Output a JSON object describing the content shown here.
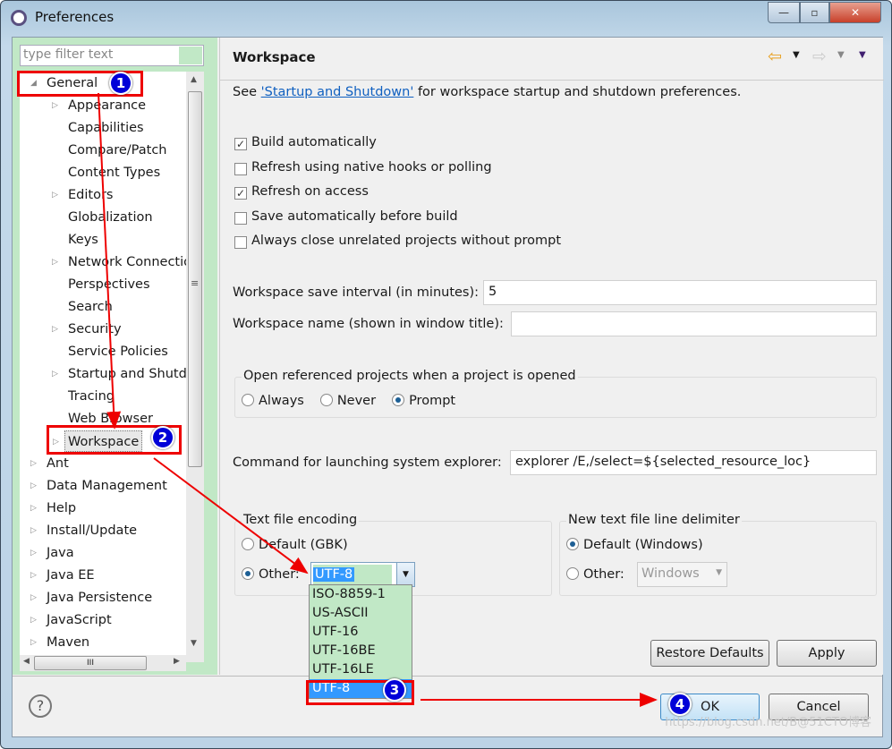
{
  "window": {
    "title": "Preferences",
    "minimize": "—",
    "maximize": "▫",
    "close": "✕"
  },
  "filter": {
    "placeholder": "type filter text"
  },
  "tree": {
    "items": [
      {
        "label": "General",
        "level": 0,
        "expander": "expanded"
      },
      {
        "label": "Appearance",
        "level": 1,
        "expander": "collapsed"
      },
      {
        "label": "Capabilities",
        "level": 1,
        "expander": "none"
      },
      {
        "label": "Compare/Patch",
        "level": 1,
        "expander": "none"
      },
      {
        "label": "Content Types",
        "level": 1,
        "expander": "none"
      },
      {
        "label": "Editors",
        "level": 1,
        "expander": "collapsed"
      },
      {
        "label": "Globalization",
        "level": 1,
        "expander": "none"
      },
      {
        "label": "Keys",
        "level": 1,
        "expander": "none"
      },
      {
        "label": "Network Connections",
        "level": 1,
        "expander": "collapsed"
      },
      {
        "label": "Perspectives",
        "level": 1,
        "expander": "none"
      },
      {
        "label": "Search",
        "level": 1,
        "expander": "none"
      },
      {
        "label": "Security",
        "level": 1,
        "expander": "collapsed"
      },
      {
        "label": "Service Policies",
        "level": 1,
        "expander": "none"
      },
      {
        "label": "Startup and Shutdown",
        "level": 1,
        "expander": "collapsed"
      },
      {
        "label": "Tracing",
        "level": 1,
        "expander": "none"
      },
      {
        "label": "Web Browser",
        "level": 1,
        "expander": "none"
      },
      {
        "label": "Workspace",
        "level": 1,
        "expander": "collapsed",
        "selected": true
      },
      {
        "label": "Ant",
        "level": 0,
        "expander": "collapsed"
      },
      {
        "label": "Data Management",
        "level": 0,
        "expander": "collapsed"
      },
      {
        "label": "Help",
        "level": 0,
        "expander": "collapsed"
      },
      {
        "label": "Install/Update",
        "level": 0,
        "expander": "collapsed"
      },
      {
        "label": "Java",
        "level": 0,
        "expander": "collapsed"
      },
      {
        "label": "Java EE",
        "level": 0,
        "expander": "collapsed"
      },
      {
        "label": "Java Persistence",
        "level": 0,
        "expander": "collapsed"
      },
      {
        "label": "JavaScript",
        "level": 0,
        "expander": "collapsed"
      },
      {
        "label": "Maven",
        "level": 0,
        "expander": "collapsed"
      }
    ]
  },
  "page": {
    "title": "Workspace",
    "see_prefix": "See ",
    "see_link": "'Startup and Shutdown'",
    "see_suffix": " for workspace startup and shutdown preferences.",
    "checkboxes": [
      {
        "label": "Build automatically",
        "checked": true
      },
      {
        "label": "Refresh using native hooks or polling",
        "checked": false
      },
      {
        "label": "Refresh on access",
        "checked": true
      },
      {
        "label": "Save automatically before build",
        "checked": false
      },
      {
        "label": "Always close unrelated projects without prompt",
        "checked": false
      }
    ],
    "save_interval_label": "Workspace save interval (in minutes):",
    "save_interval_value": "5",
    "name_label": "Workspace name (shown in window title):",
    "name_value": "",
    "open_ref": {
      "legend": "Open referenced projects when a project is opened",
      "options": [
        "Always",
        "Never",
        "Prompt"
      ],
      "selected": "Prompt"
    },
    "explorer_label": "Command for launching system explorer:",
    "explorer_value": "explorer /E,/select=${selected_resource_loc}",
    "encoding": {
      "legend": "Text file encoding",
      "default_label": "Default (GBK)",
      "other_label": "Other:",
      "value": "UTF-8",
      "selected": "Other",
      "options": [
        "ISO-8859-1",
        "US-ASCII",
        "UTF-16",
        "UTF-16BE",
        "UTF-16LE",
        "UTF-8"
      ],
      "highlighted": "UTF-8"
    },
    "delimiter": {
      "legend": "New text file line delimiter",
      "default_label": "Default (Windows)",
      "other_label": "Other:",
      "value": "Windows",
      "selected": "Default"
    },
    "restore_defaults": "Restore Defaults",
    "apply": "Apply"
  },
  "footer": {
    "help": "?",
    "ok": "OK",
    "cancel": "Cancel"
  },
  "annotations": {
    "badges": [
      "1",
      "2",
      "3",
      "4"
    ],
    "color": "#ee0000",
    "badge_color": "#0000d8"
  },
  "watermark": "https://blog.csdn.net/B@51CTO博客"
}
